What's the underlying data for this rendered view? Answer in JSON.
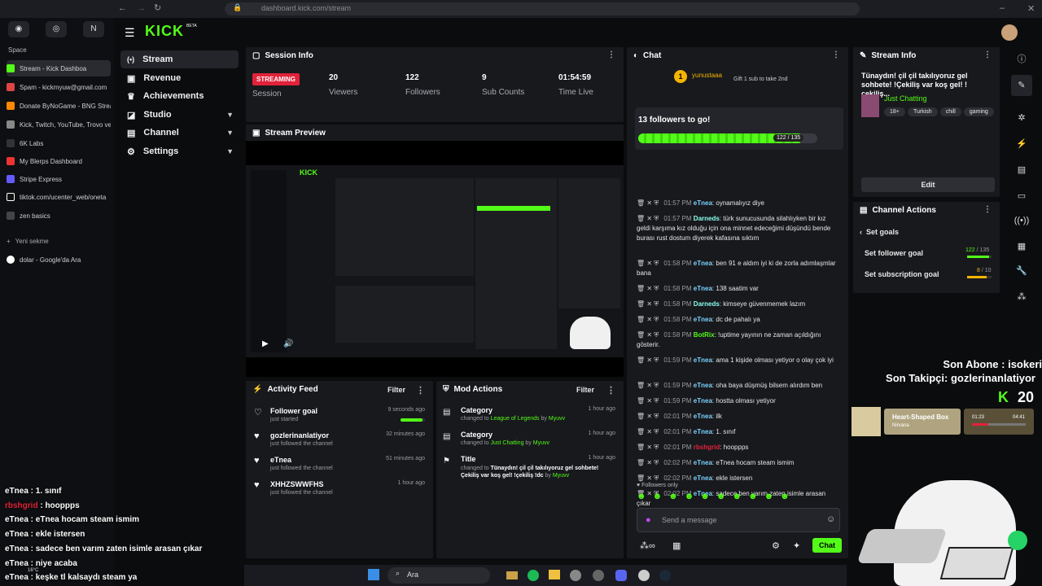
{
  "browser": {
    "url": "dashboard.kick.com/stream",
    "space_label": "Space",
    "new_tab": "Yeni sekme",
    "tabs": [
      "Stream - Kick Dashboa",
      "Spam - kickmyuw@gmail.com",
      "Donate ByNoGame - BNG Strea",
      "Kick, Twitch, YouTube, Trovo ve",
      "6K Labs",
      "My Blerps Dashboard",
      "Stripe Express",
      "tiktok.com/ucenter_web/oneta",
      "zen basics"
    ],
    "extra_tab": "dolar - Google'da Ara"
  },
  "brand": {
    "logo": "KICK",
    "badge": "BETA"
  },
  "nav": [
    {
      "label": "Stream",
      "icon": "stream-icon"
    },
    {
      "label": "Revenue",
      "icon": "revenue-icon"
    },
    {
      "label": "Achievements",
      "icon": "trophy-icon"
    },
    {
      "label": "Studio",
      "icon": "studio-icon"
    },
    {
      "label": "Channel",
      "icon": "channel-icon"
    },
    {
      "label": "Settings",
      "icon": "gear-icon"
    }
  ],
  "session": {
    "title": "Session Info",
    "badge": "STREAMING",
    "badge_sub": "Session",
    "stats": [
      {
        "value": "20",
        "label": "Viewers"
      },
      {
        "value": "122",
        "label": "Followers"
      },
      {
        "value": "9",
        "label": "Sub Counts"
      },
      {
        "value": "01:54:59",
        "label": "Time Live"
      }
    ]
  },
  "preview": {
    "title": "Stream Preview"
  },
  "activity": {
    "title": "Activity Feed",
    "filter": "Filter",
    "items": [
      {
        "name": "Follower goal",
        "sub": "just started",
        "time": "9 seconds ago"
      },
      {
        "name": "gozlerinanlatiyor",
        "sub": "just followed the channel",
        "time": "32 minutes ago"
      },
      {
        "name": "eTnea",
        "sub": "just followed the channel",
        "time": "51 minutes ago"
      },
      {
        "name": "XHHZSWWFHS",
        "sub": "just followed the channel",
        "time": "1 hour ago"
      }
    ]
  },
  "mod": {
    "title": "Mod Actions",
    "filter": "Filter",
    "items": [
      {
        "name": "Category",
        "pre": "changed to",
        "target": "League of Legends",
        "by": "by",
        "user": "Myuvv",
        "time": "1 hour ago"
      },
      {
        "name": "Category",
        "pre": "changed to",
        "target": "Just Chatting",
        "by": "by",
        "user": "Myuvv",
        "time": "1 hour ago"
      },
      {
        "name": "Title",
        "pre": "changed to",
        "target": "Tünaydın! çil çil takılıyoruz gel sohbete! Çekiliş var koş gel! !çekiliş !dc",
        "by": "by",
        "user": "Myuvv",
        "time": "1 hour ago"
      }
    ]
  },
  "chat": {
    "title": "Chat",
    "pinned_user": "yunustaaa",
    "pinned_count": "1",
    "gift_text": "Gift 1 sub to take 2nd",
    "goal_text": "13 followers to go!",
    "goal_progress": "122 / 135",
    "goal_fraction": 0.904,
    "messages": [
      {
        "time": "01:57 PM",
        "user": "eTnea",
        "text": "oynamalıyız diye"
      },
      {
        "time": "01:57 PM",
        "user": "Darneds",
        "text": "türk sunucusunda silahlıyken bir kız geldi karşıma kız olduğu için ona minnet edeceğimi düşündü bende burası rust dostum diyerek kafasına sıktım"
      },
      {
        "time": "01:58 PM",
        "user": "eTnea",
        "text": "ben 91 e aldım iyi ki de zorla adımlaşmlar bana"
      },
      {
        "time": "01:58 PM",
        "user": "eTnea",
        "text": "138 saatim var"
      },
      {
        "time": "01:58 PM",
        "user": "Darneds",
        "text": "kimseye güvenmemek lazım"
      },
      {
        "time": "01:58 PM",
        "user": "eTnea",
        "text": "dc de pahalı ya"
      },
      {
        "time": "01:58 PM",
        "user": "BotRix",
        "text": "!uptime yayının ne zaman açıldığını gösterir."
      },
      {
        "time": "01:59 PM",
        "user": "eTnea",
        "text": "ama 1 kişide olması yetiyor o olay çok iyi"
      },
      {
        "time": "01:59 PM",
        "user": "eTnea",
        "text": "oha baya düşmüş bilsem alırdım ben"
      },
      {
        "time": "01:59 PM",
        "user": "eTnea",
        "text": "hostta olması yetiyor"
      },
      {
        "time": "02:01 PM",
        "user": "eTnea",
        "text": "ilk"
      },
      {
        "time": "02:01 PM",
        "user": "eTnea",
        "text": "1. sınıf"
      },
      {
        "time": "02:01 PM",
        "user": "rbshgrid",
        "text": "hooppps"
      },
      {
        "time": "02:02 PM",
        "user": "eTnea",
        "text": "eTnea hocam steam ismim"
      },
      {
        "time": "02:02 PM",
        "user": "eTnea",
        "text": "ekle istersen"
      },
      {
        "time": "02:02 PM",
        "user": "eTnea",
        "text": "sadece ben varım zaten isimle arasan çıkar"
      },
      {
        "time": "02:03 PM",
        "user": "eTnea",
        "text": "niye acaba"
      },
      {
        "time": "02:04 PM",
        "user": "eTnea",
        "text": "keşke tl kalsaydı steam ya"
      }
    ],
    "followers_only": "Followers only",
    "placeholder": "Send a message",
    "send": "Chat"
  },
  "stream_info": {
    "title": "Stream Info",
    "stream_title": "Tünaydın! çil çil takılıyoruz gel sohbete! !Çekiliş var koş gel! !çekiliş...",
    "category": "Just Chatting",
    "tags": [
      "18+",
      "Turkish",
      "chill",
      "gaming"
    ],
    "edit": "Edit"
  },
  "channel_actions": {
    "title": "Channel Actions",
    "back": "Set goals",
    "goals": [
      {
        "label": "Set follower goal",
        "value": "122",
        "max": "/ 135",
        "fraction": 0.904
      },
      {
        "label": "Set subscription goal",
        "value": "8",
        "max": "/ 10",
        "fraction": 0.8
      }
    ]
  },
  "overlay": {
    "sub_line": "Son Abone : isokeri",
    "follow_line": "Son Takipçi: gozlerinanlatiyor",
    "viewer_count": "20",
    "song": "Heart-Shaped Box",
    "artist": "Nirvana",
    "t_cur": "01:23",
    "t_total": "04:41",
    "chat": [
      {
        "user": "eTnea",
        "text": "1. sınıf"
      },
      {
        "user": "rbshgrid",
        "text": "hooppps"
      },
      {
        "user": "eTnea",
        "text": "eTnea hocam steam ismim"
      },
      {
        "user": "eTnea",
        "text": "ekle istersen"
      },
      {
        "user": "eTnea",
        "text": "sadece ben varım zaten isimle arasan çıkar"
      },
      {
        "user": "eTnea",
        "text": "niye acaba"
      },
      {
        "user": "eTnea",
        "text": "keşke tl kalsaydı steam ya"
      }
    ]
  },
  "taskbar": {
    "search": "Ara",
    "temp": "16°C"
  }
}
